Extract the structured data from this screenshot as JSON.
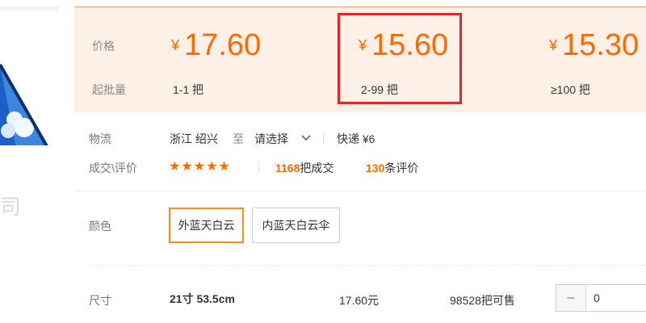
{
  "thumbnail": {
    "watermark": "司"
  },
  "price": {
    "label_price": "价格",
    "label_moq": "起批量",
    "currency": "¥",
    "tiers": [
      {
        "price": "17.60",
        "qty": "1-1 把"
      },
      {
        "price": "15.60",
        "qty": "2-99 把",
        "highlighted": true
      },
      {
        "price": "15.30",
        "qty": "≥100 把"
      }
    ]
  },
  "logistics": {
    "label": "物流",
    "origin": "浙江 绍兴",
    "to": "至",
    "select": "请选择",
    "express": "快递 ¥6"
  },
  "rating": {
    "label": "成交\\评价",
    "stars": "★★★★★",
    "deals_count": "1168",
    "deals_suffix": "把成交",
    "reviews_count": "130",
    "reviews_suffix": "条评价"
  },
  "color": {
    "label": "颜色",
    "options": [
      {
        "label": "外蓝天白云",
        "selected": true
      },
      {
        "label": "内蓝天白云伞",
        "selected": false
      }
    ]
  },
  "size": {
    "label": "尺寸",
    "name": "21寸 53.5cm",
    "price": "17.60元",
    "stock": "98528把可售",
    "minus": "−",
    "quantity": "0"
  },
  "colors": {
    "accent": "#ff6a00",
    "band": "#fdf0e6",
    "highlight": "#e0262c"
  }
}
